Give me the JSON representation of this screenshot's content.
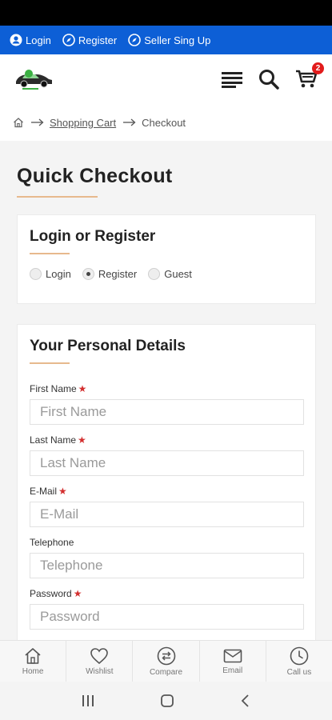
{
  "topbar": {
    "links": [
      {
        "label": "Login",
        "icon": "user-icon"
      },
      {
        "label": "Register",
        "icon": "compass-icon"
      },
      {
        "label": "Seller Sing Up",
        "icon": "compass-icon"
      }
    ],
    "bg_color": "#0d5fd6"
  },
  "header": {
    "icons": [
      "menu-icon",
      "search-icon",
      "cart-icon"
    ],
    "cart_count": "2"
  },
  "breadcrumb": {
    "items": [
      "Shopping Cart",
      "Checkout"
    ]
  },
  "page": {
    "title": "Quick Checkout"
  },
  "login_card": {
    "title": "Login or Register",
    "options": [
      {
        "label": "Login",
        "checked": false
      },
      {
        "label": "Register",
        "checked": true
      },
      {
        "label": "Guest",
        "checked": false
      }
    ]
  },
  "personal_card": {
    "title": "Your Personal Details",
    "fields": [
      {
        "label": "First Name",
        "placeholder": "First Name",
        "required": true
      },
      {
        "label": "Last Name",
        "placeholder": "Last Name",
        "required": true
      },
      {
        "label": "E-Mail",
        "placeholder": "E-Mail",
        "required": true
      },
      {
        "label": "Telephone",
        "placeholder": "Telephone",
        "required": false
      },
      {
        "label": "Password",
        "placeholder": "Password",
        "required": true
      }
    ],
    "required_mark": "★"
  },
  "bottom_nav": {
    "items": [
      {
        "label": "Home",
        "icon": "home-icon"
      },
      {
        "label": "Wishlist",
        "icon": "heart-icon"
      },
      {
        "label": "Compare",
        "icon": "compare-icon"
      },
      {
        "label": "Email",
        "icon": "mail-icon"
      },
      {
        "label": "Call us",
        "icon": "clock-icon"
      }
    ]
  }
}
